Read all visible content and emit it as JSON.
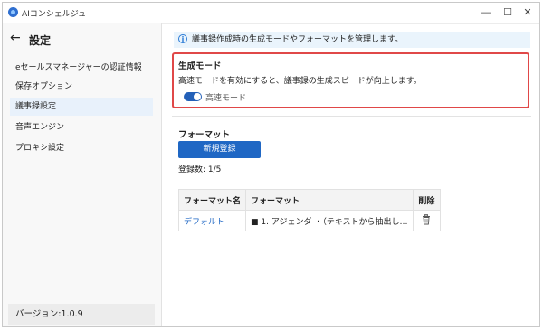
{
  "window": {
    "title": "AIコンシェルジュ",
    "controls": [
      "—",
      "☐",
      "✕"
    ]
  },
  "sidebar": {
    "title": "設定",
    "items": [
      {
        "label": "eセールスマネージャーの認証情報",
        "active": false
      },
      {
        "label": "保存オプション",
        "active": false
      },
      {
        "label": "議事録設定",
        "active": true
      },
      {
        "label": "音声エンジン",
        "active": false
      },
      {
        "label": "プロキシ設定",
        "active": false
      }
    ],
    "version": "バージョン:1.0.9"
  },
  "main": {
    "info": "議事録作成時の生成モードやフォーマットを管理します。",
    "mode": {
      "title": "生成モード",
      "description": "高速モードを有効にすると、議事録の生成スピードが向上します。",
      "toggle_label": "高速モード",
      "toggle_on": true
    },
    "format": {
      "title": "フォーマット",
      "new_button": "新規登録",
      "count": "登録数: 1/5",
      "columns": [
        "フォーマット名",
        "フォーマット",
        "削除"
      ],
      "rows": [
        {
          "name": "デフォルト",
          "format": "■ 1. アジェンダ ・（テキストから抽出し…"
        }
      ]
    }
  },
  "colors": {
    "accent": "#1f67c4",
    "highlight_border": "#e04848",
    "info_bg": "#eaf4fc"
  }
}
